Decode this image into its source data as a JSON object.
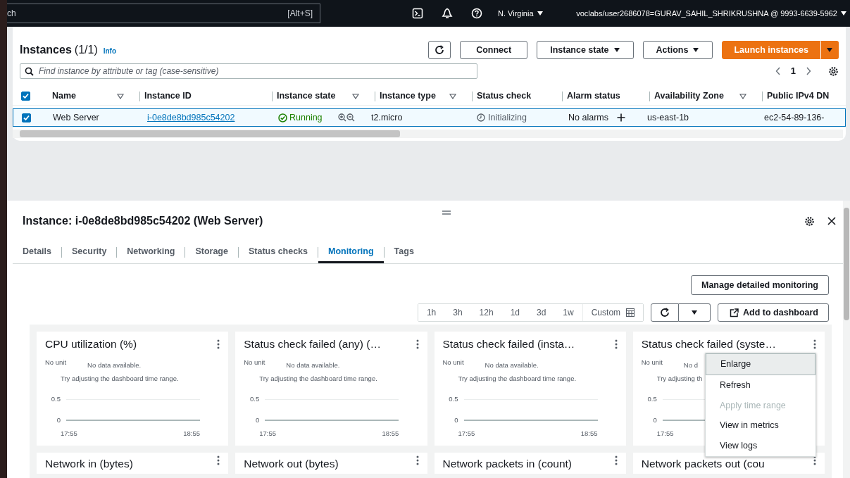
{
  "top_bar": {
    "search_placeholder": "ch",
    "shortcut": "[Alt+S]",
    "region": "N. Virginia",
    "account": "voclabs/user2686078=GURAV_SAHIL_SHRIKRUSHNA @ 9993-6639-5962"
  },
  "instances": {
    "title": "Instances",
    "count": "(1/1)",
    "info": "Info",
    "buttons": [
      {
        "kind": "refresh"
      },
      {
        "kind": "plain",
        "label": "Connect"
      },
      {
        "kind": "dropdown",
        "label": "Instance state"
      },
      {
        "kind": "dropdown",
        "label": "Actions"
      },
      {
        "kind": "primary",
        "label": "Launch instances"
      }
    ],
    "search_placeholder": "Find instance by attribute or tag (case-sensitive)",
    "page": "1",
    "all_checked": true,
    "columns": [
      {
        "label": "Name",
        "filter": true
      },
      {
        "label": "Instance ID",
        "filter": false
      },
      {
        "label": "Instance state",
        "filter": true
      },
      {
        "label": "Instance type",
        "filter": true
      },
      {
        "label": "Status check",
        "filter": false
      },
      {
        "label": "Alarm status",
        "filter": false
      },
      {
        "label": "Availability Zone",
        "filter": true
      },
      {
        "label": "Public IPv4 DN",
        "filter": false
      }
    ],
    "rows": [
      {
        "selected": true,
        "name": "Web Server",
        "instance_id": "i-0e8de8bd985c54202",
        "state": "Running",
        "type": "t2.micro",
        "status_check": "Initializing",
        "alarm_status": "No alarms",
        "zone": "us-east-1b",
        "dns": "ec2-54-89-136-"
      }
    ]
  },
  "details": {
    "title": "Instance: i-0e8de8bd985c54202 (Web Server)",
    "tabs": [
      {
        "label": "Details",
        "selected": false
      },
      {
        "label": "Security",
        "selected": false
      },
      {
        "label": "Networking",
        "selected": false
      },
      {
        "label": "Storage",
        "selected": false
      },
      {
        "label": "Status checks",
        "selected": false
      },
      {
        "label": "Monitoring",
        "selected": true
      },
      {
        "label": "Tags",
        "selected": false
      }
    ],
    "manage_button": "Manage detailed monitoring",
    "time_ranges": [
      {
        "label": "1h",
        "selected": false
      },
      {
        "label": "3h",
        "selected": false
      },
      {
        "label": "12h",
        "selected": false
      },
      {
        "label": "1d",
        "selected": false
      },
      {
        "label": "3d",
        "selected": false
      },
      {
        "label": "1w",
        "selected": false
      }
    ],
    "custom": "Custom",
    "add_button": "Add to dashboard",
    "widgets": [
      {
        "title": "CPU utilization (%)",
        "unit": "No unit",
        "message": "No data available.",
        "hint": "Try adjusting the dashboard time range.",
        "y_labels": [
          "0.5",
          "0"
        ],
        "x_labels": [
          "17:55",
          "18:55"
        ]
      },
      {
        "title": "Status check failed (any) (…",
        "unit": "No unit",
        "message": "No data available.",
        "hint": "Try adjusting the dashboard time range.",
        "y_labels": [
          "0.5",
          "0"
        ],
        "x_labels": [
          "17:55",
          "18:55"
        ]
      },
      {
        "title": "Status check failed (insta…",
        "unit": "No unit",
        "message": "No data available.",
        "hint": "Try adjusting the dashboard time range.",
        "y_labels": [
          "0.5",
          "0"
        ],
        "x_labels": [
          "17:55",
          "18:55"
        ]
      },
      {
        "title": "Status check failed (syste…",
        "unit": "No unit",
        "message": "No d",
        "hint": "Try adjusting th",
        "y_labels": [
          "0.5",
          "0"
        ],
        "x_labels": [
          "17:55"
        ],
        "menu": [
          {
            "label": "Enlarge",
            "selected": true,
            "disabled": false
          },
          {
            "label": "Refresh",
            "selected": false,
            "disabled": false
          },
          {
            "label": "Apply time range",
            "selected": false,
            "disabled": true
          },
          {
            "label": "View in metrics",
            "selected": false,
            "disabled": false
          },
          {
            "label": "View logs",
            "selected": false,
            "disabled": false
          }
        ]
      }
    ],
    "more_widgets": [
      "Network in (bytes)",
      "Network out (bytes)",
      "Network packets in (count)",
      "Network packets out (cou"
    ]
  }
}
